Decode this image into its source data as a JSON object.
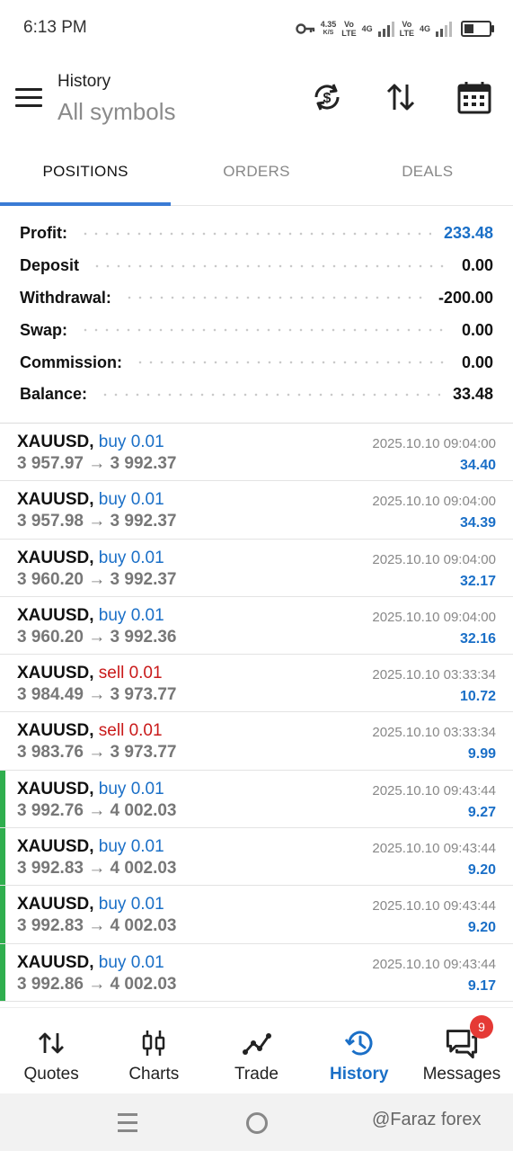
{
  "status_bar": {
    "time": "6:13 PM",
    "net_speed": "4.35",
    "net_unit": "K/S",
    "sim1_top": "Vo",
    "sim1_bottom": "LTE",
    "sim1_gen": "4G",
    "sim2_top": "Vo",
    "sim2_bottom": "LTE",
    "sim2_gen": "4G"
  },
  "header": {
    "title": "History",
    "subtitle": "All symbols",
    "icons": [
      "sync-dollar-icon",
      "sort-icon",
      "calendar-icon"
    ]
  },
  "tabs": [
    {
      "label": "POSITIONS",
      "active": true
    },
    {
      "label": "ORDERS",
      "active": false
    },
    {
      "label": "DEALS",
      "active": false
    }
  ],
  "summary": [
    {
      "label": "Profit:",
      "value": "233.48",
      "accent": true
    },
    {
      "label": "Deposit",
      "value": "0.00",
      "accent": false
    },
    {
      "label": "Withdrawal:",
      "value": "-200.00",
      "accent": false
    },
    {
      "label": "Swap:",
      "value": "0.00",
      "accent": false
    },
    {
      "label": "Commission:",
      "value": "0.00",
      "accent": false
    },
    {
      "label": "Balance:",
      "value": "33.48",
      "accent": false
    }
  ],
  "trades": [
    {
      "symbol": "XAUUSD,",
      "side": "buy 0.01",
      "type": "buy",
      "open": "3 957.97",
      "close": "3 992.37",
      "time": "2025.10.10 09:04:00",
      "profit": "34.40",
      "highlight": false
    },
    {
      "symbol": "XAUUSD,",
      "side": "buy 0.01",
      "type": "buy",
      "open": "3 957.98",
      "close": "3 992.37",
      "time": "2025.10.10 09:04:00",
      "profit": "34.39",
      "highlight": false
    },
    {
      "symbol": "XAUUSD,",
      "side": "buy 0.01",
      "type": "buy",
      "open": "3 960.20",
      "close": "3 992.37",
      "time": "2025.10.10 09:04:00",
      "profit": "32.17",
      "highlight": false
    },
    {
      "symbol": "XAUUSD,",
      "side": "buy 0.01",
      "type": "buy",
      "open": "3 960.20",
      "close": "3 992.36",
      "time": "2025.10.10 09:04:00",
      "profit": "32.16",
      "highlight": false
    },
    {
      "symbol": "XAUUSD,",
      "side": "sell 0.01",
      "type": "sell",
      "open": "3 984.49",
      "close": "3 973.77",
      "time": "2025.10.10 03:33:34",
      "profit": "10.72",
      "highlight": false
    },
    {
      "symbol": "XAUUSD,",
      "side": "sell 0.01",
      "type": "sell",
      "open": "3 983.76",
      "close": "3 973.77",
      "time": "2025.10.10 03:33:34",
      "profit": "9.99",
      "highlight": false
    },
    {
      "symbol": "XAUUSD,",
      "side": "buy 0.01",
      "type": "buy",
      "open": "3 992.76",
      "close": "4 002.03",
      "time": "2025.10.10 09:43:44",
      "profit": "9.27",
      "highlight": true
    },
    {
      "symbol": "XAUUSD,",
      "side": "buy 0.01",
      "type": "buy",
      "open": "3 992.83",
      "close": "4 002.03",
      "time": "2025.10.10 09:43:44",
      "profit": "9.20",
      "highlight": true
    },
    {
      "symbol": "XAUUSD,",
      "side": "buy 0.01",
      "type": "buy",
      "open": "3 992.83",
      "close": "4 002.03",
      "time": "2025.10.10 09:43:44",
      "profit": "9.20",
      "highlight": true
    },
    {
      "symbol": "XAUUSD,",
      "side": "buy 0.01",
      "type": "buy",
      "open": "3 992.86",
      "close": "4 002.03",
      "time": "2025.10.10 09:43:44",
      "profit": "9.17",
      "highlight": true
    }
  ],
  "arrow": "→",
  "bottom_nav": [
    {
      "label": "Quotes",
      "icon": "quotes-icon",
      "active": false
    },
    {
      "label": "Charts",
      "icon": "charts-icon",
      "active": false
    },
    {
      "label": "Trade",
      "icon": "trade-icon",
      "active": false
    },
    {
      "label": "History",
      "icon": "history-icon",
      "active": true
    },
    {
      "label": "Messages",
      "icon": "messages-icon",
      "active": false,
      "badge": "9"
    }
  ],
  "watermark": "@Faraz forex",
  "colors": {
    "accent": "#1a6fc7",
    "sell": "#c91a1a",
    "highlight": "#2fae4e",
    "tab_underline": "#3a7bd5"
  }
}
